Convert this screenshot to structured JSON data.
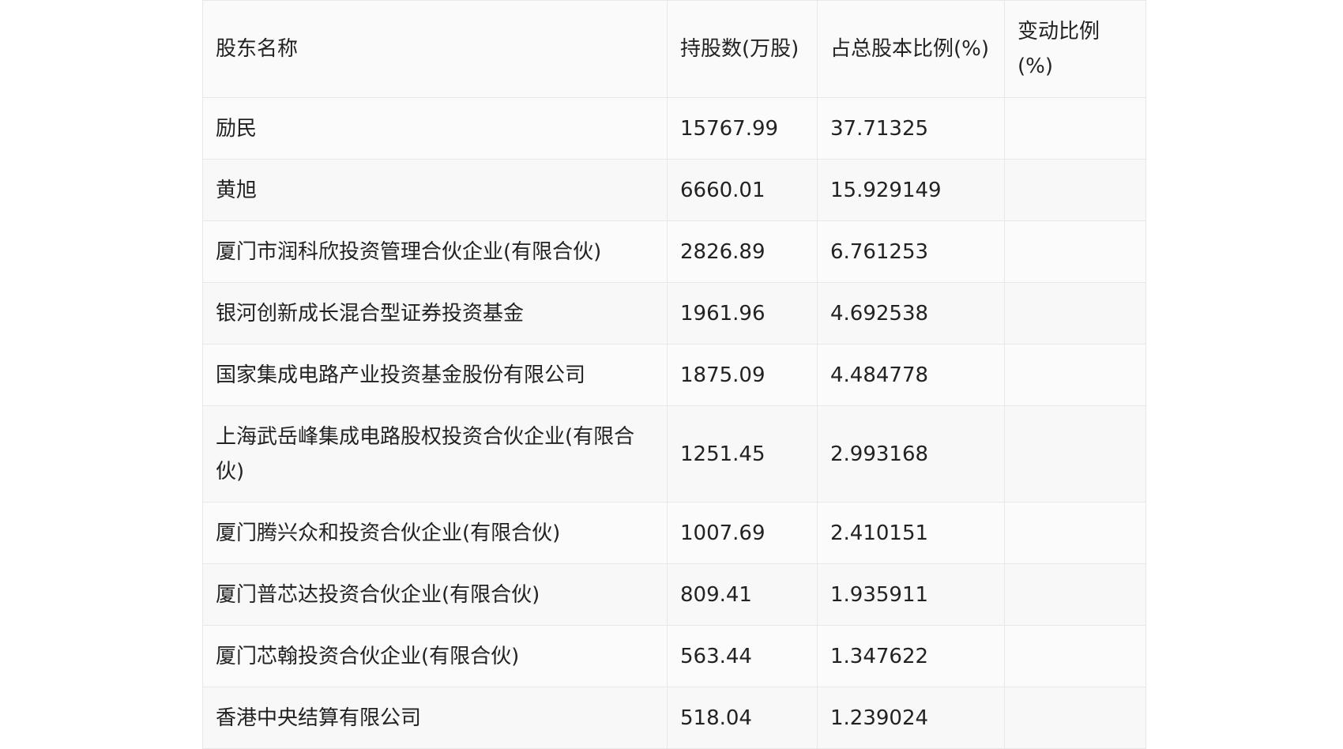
{
  "table": {
    "headers": [
      "股东名称",
      "持股数(万股)",
      "占总股本比例(%)",
      "变动比例(%)"
    ],
    "rows": [
      {
        "name": "励民",
        "shares": "15767.99",
        "ratio": "37.71325",
        "change": ""
      },
      {
        "name": "黄旭",
        "shares": "6660.01",
        "ratio": "15.929149",
        "change": ""
      },
      {
        "name": "厦门市润科欣投资管理合伙企业(有限合伙)",
        "shares": "2826.89",
        "ratio": "6.761253",
        "change": ""
      },
      {
        "name": "银河创新成长混合型证券投资基金",
        "shares": "1961.96",
        "ratio": "4.692538",
        "change": ""
      },
      {
        "name": "国家集成电路产业投资基金股份有限公司",
        "shares": "1875.09",
        "ratio": "4.484778",
        "change": ""
      },
      {
        "name": "上海武岳峰集成电路股权投资合伙企业(有限合伙)",
        "shares": "1251.45",
        "ratio": "2.993168",
        "change": ""
      },
      {
        "name": "厦门腾兴众和投资合伙企业(有限合伙)",
        "shares": "1007.69",
        "ratio": "2.410151",
        "change": ""
      },
      {
        "name": "厦门普芯达投资合伙企业(有限合伙)",
        "shares": "809.41",
        "ratio": "1.935911",
        "change": ""
      },
      {
        "name": "厦门芯翰投资合伙企业(有限合伙)",
        "shares": "563.44",
        "ratio": "1.347622",
        "change": ""
      },
      {
        "name": "香港中央结算有限公司",
        "shares": "518.04",
        "ratio": "1.239024",
        "change": ""
      }
    ]
  }
}
